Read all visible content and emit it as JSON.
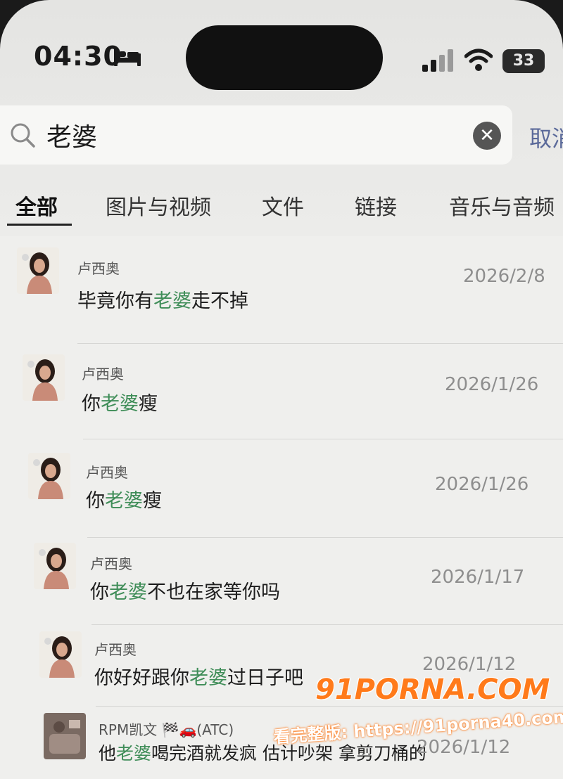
{
  "status_bar": {
    "time": "04:30",
    "battery": "33"
  },
  "search": {
    "query": "老婆",
    "cancel_label": "取消"
  },
  "tabs": [
    {
      "label": "全部"
    },
    {
      "label": "图片与视频"
    },
    {
      "label": "文件"
    },
    {
      "label": "链接"
    },
    {
      "label": "音乐与音频"
    }
  ],
  "results": [
    {
      "sender": "卢西奥",
      "pre": "毕竟你有",
      "keyword": "老婆",
      "post": "走不掉",
      "date": "2026/2/8"
    },
    {
      "sender": "卢西奥",
      "pre": "你",
      "keyword": "老婆",
      "post": "瘦",
      "date": "2026/1/26"
    },
    {
      "sender": "卢西奥",
      "pre": "你",
      "keyword": "老婆",
      "post": "瘦",
      "date": "2026/1/26"
    },
    {
      "sender": "卢西奥",
      "pre": "你",
      "keyword": "老婆",
      "post": "不也在家等你吗",
      "date": "2026/1/17"
    },
    {
      "sender": "卢西奥",
      "pre": "你好好跟你",
      "keyword": "老婆",
      "post": "过日子吧",
      "date": "2026/1/12"
    },
    {
      "sender": "RPM凯文 🏁🚗(ATC)",
      "pre": "他",
      "keyword": "老婆",
      "post": "喝完酒就发疯 估计吵架 拿剪刀桶的",
      "date": "2026/1/12"
    }
  ],
  "watermark": {
    "logo": "91PORNA.COM",
    "url": "看完整版: https://91porna40.com"
  },
  "colors": {
    "highlight": "#3f8d58",
    "cancel": "#5b6a9a",
    "watermark": "#ff7a1a"
  }
}
